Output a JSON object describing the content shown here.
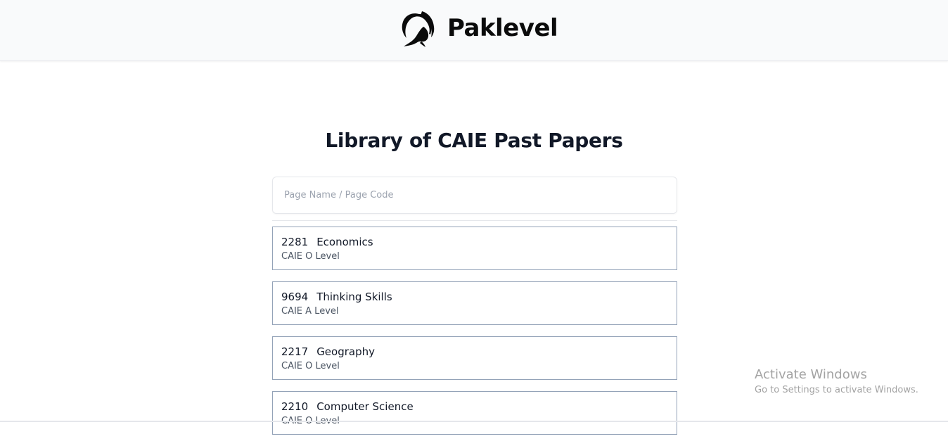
{
  "header": {
    "brand_name": "Paklevel",
    "logo_icon": "ibex-logo-icon"
  },
  "main": {
    "title": "Library of CAIE Past Papers",
    "search": {
      "placeholder": "Page Name / Page Code",
      "value": ""
    },
    "subjects": [
      {
        "code": "2281",
        "name": "Economics",
        "level": "CAIE O Level"
      },
      {
        "code": "9694",
        "name": "Thinking Skills",
        "level": "CAIE A Level"
      },
      {
        "code": "2217",
        "name": "Geography",
        "level": "CAIE O Level"
      },
      {
        "code": "2210",
        "name": "Computer Science",
        "level": "CAIE O Level"
      }
    ]
  },
  "watermark": {
    "title": "Activate Windows",
    "subtitle": "Go to Settings to activate Windows."
  },
  "colors": {
    "header_bg": "#f9fafb",
    "card_border": "#94a3b8",
    "title_text": "#111827",
    "muted_text": "#4b5563"
  }
}
